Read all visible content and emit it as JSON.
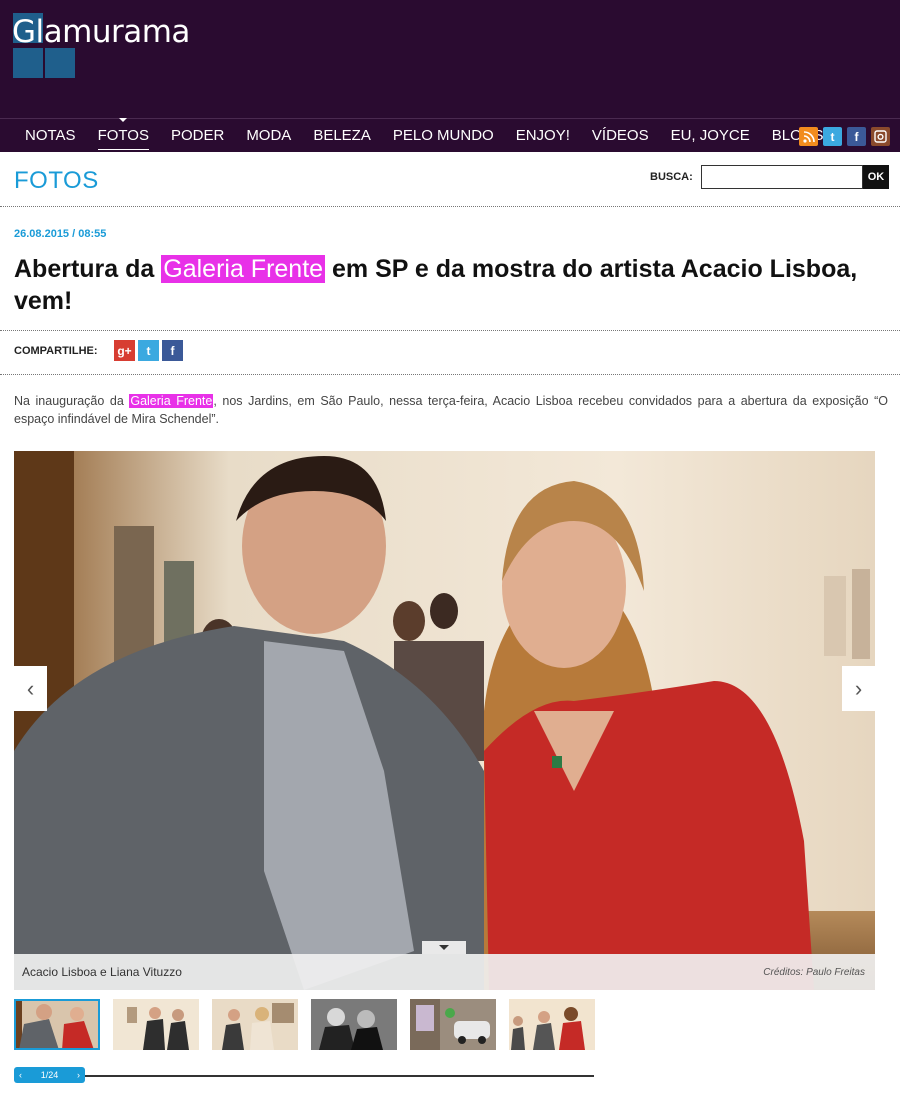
{
  "site": {
    "logo": "Glamurama"
  },
  "nav": {
    "items": [
      {
        "label": "NOTAS",
        "active": false
      },
      {
        "label": "FOTOS",
        "active": true
      },
      {
        "label": "PODER",
        "active": false
      },
      {
        "label": "MODA",
        "active": false
      },
      {
        "label": "BELEZA",
        "active": false
      },
      {
        "label": "PELO MUNDO",
        "active": false
      },
      {
        "label": "ENJOY!",
        "active": false
      },
      {
        "label": "VÍDEOS",
        "active": false
      },
      {
        "label": "EU, JOYCE",
        "active": false
      },
      {
        "label": "BLOGS",
        "active": false
      }
    ],
    "social_icons": [
      "rss-icon",
      "twitter-icon",
      "facebook-icon",
      "instagram-icon"
    ]
  },
  "section": {
    "title": "FOTOS"
  },
  "search": {
    "label": "BUSCA:",
    "value": "",
    "button_label": "OK"
  },
  "article": {
    "date": "26.08.2015 / 08:55",
    "headline_before": "Abertura da ",
    "headline_highlight": "Galeria Frente",
    "headline_after": " em SP e da mostra do artista Acacio Lisboa, vem!",
    "share_label": "COMPARTILHE:",
    "share_icons": [
      "google-plus-icon",
      "twitter-icon",
      "facebook-icon"
    ],
    "body_before": "Na inauguração da ",
    "body_highlight": "Galeria Frente",
    "body_after": ", nos Jardins, em São Paulo, nessa terça-feira, Acacio Lisboa recebeu convidados para a abertura da exposição “O espaço infindável de Mira Schendel”."
  },
  "gallery": {
    "caption": "Acacio Lisboa e Liana Vituzzo",
    "credits": "Créditos: Paulo Freitas",
    "pager": "1/24",
    "prev": "‹",
    "next": "›"
  },
  "colors": {
    "header_bg": "#2a0b30",
    "accent_blue": "#1a9bd7",
    "highlight_magenta": "#e831e8"
  }
}
